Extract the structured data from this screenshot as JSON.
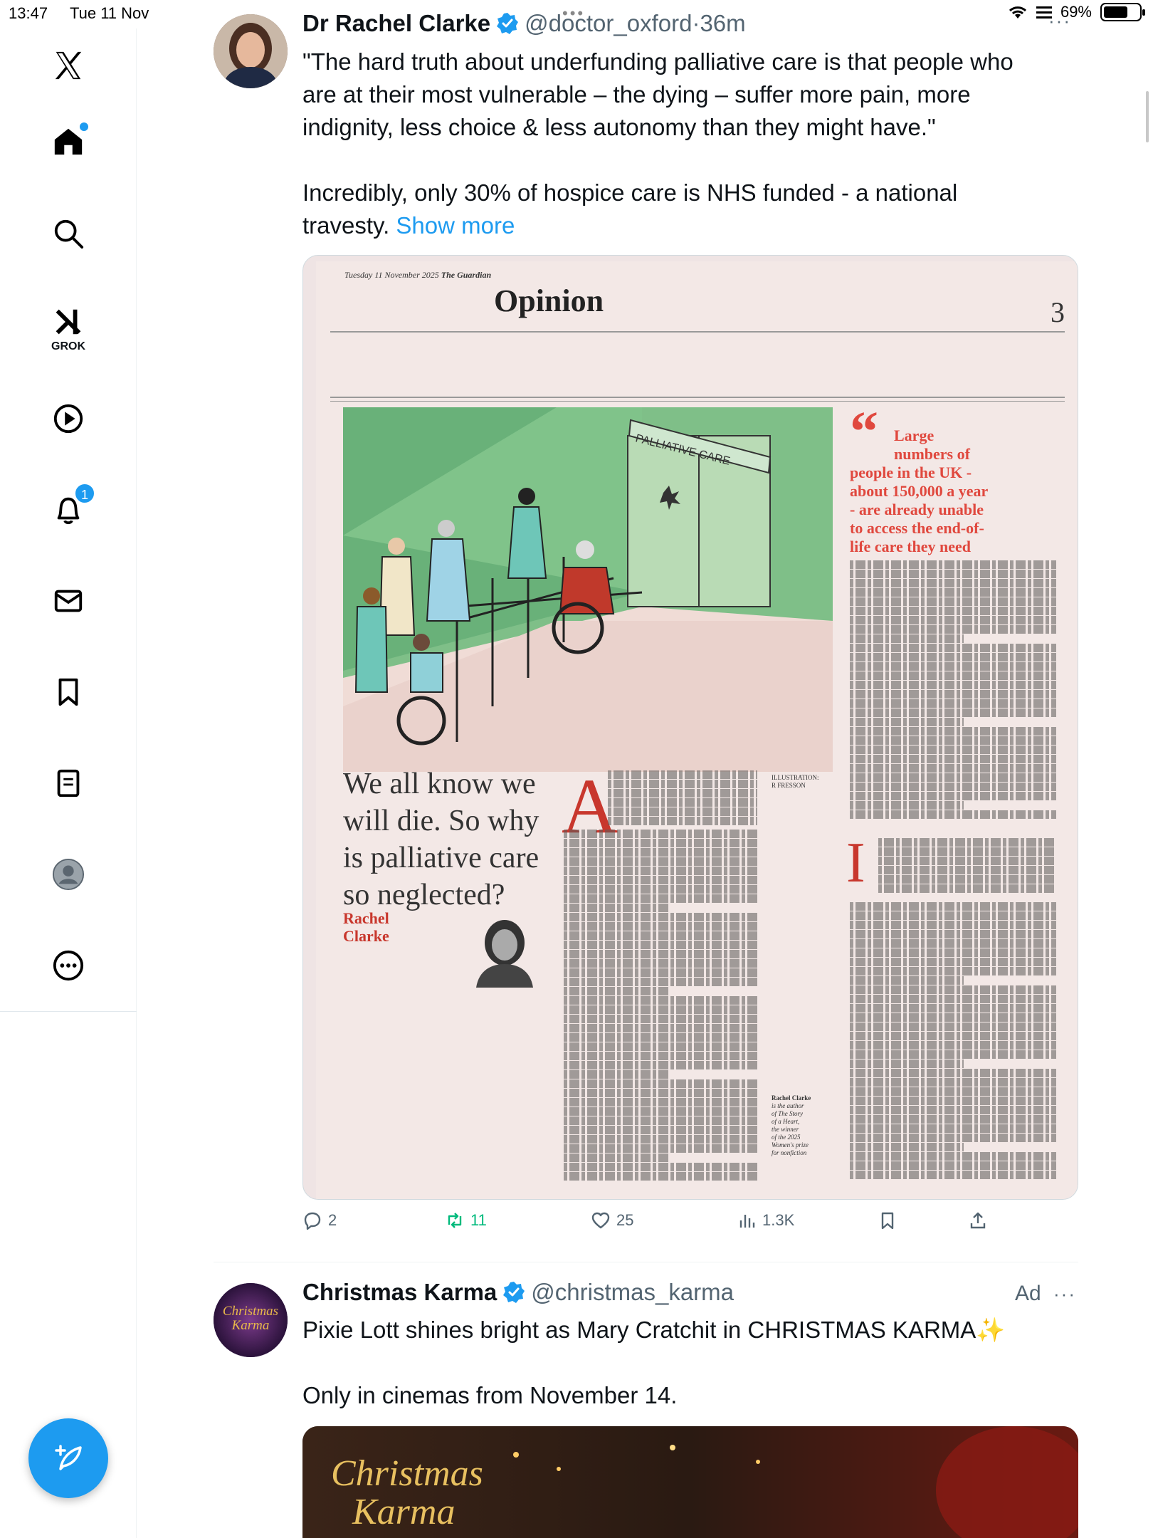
{
  "status_bar": {
    "time": "13:47",
    "date": "Tue 11 Nov",
    "battery": "69%",
    "battery_level": 0.69
  },
  "sidebar": {
    "logo": "x-logo-icon",
    "items": [
      {
        "icon": "home-icon",
        "label": ""
      },
      {
        "icon": "search-icon",
        "label": ""
      },
      {
        "icon": "grok-icon",
        "label": "GROK"
      },
      {
        "icon": "play-icon",
        "label": ""
      },
      {
        "icon": "bell-icon",
        "label": "",
        "badge": "1"
      },
      {
        "icon": "mail-icon",
        "label": ""
      },
      {
        "icon": "bookmark-icon",
        "label": ""
      },
      {
        "icon": "list-icon",
        "label": ""
      },
      {
        "icon": "profile-icon",
        "label": ""
      },
      {
        "icon": "more-icon",
        "label": ""
      }
    ],
    "compose_icon": "compose-icon"
  },
  "tweet1": {
    "name": "Dr Rachel Clarke",
    "handle": "@doctor_oxford",
    "time": "36m",
    "text_lines": [
      "\"The hard truth about underfunding palliative care is that people who",
      "are at their most vulnerable – the dying – suffer more pain, more",
      "indignity, less choice & less autonomy than they might have.\""
    ],
    "text_line4": "Incredibly, only 30% of hospice care is NHS funded - a national",
    "text_line5_pre": "travesty. ",
    "show_more": "Show more",
    "media": {
      "date": "Tuesday 11 November 2025",
      "paper": "The Guardian",
      "section": "Opinion",
      "page": "3",
      "sign_text": "PALLIATIVE CARE",
      "pull_quote_lines": [
        "Large",
        "numbers of",
        "people in the UK -",
        "about 150,000 a year",
        "- are already unable",
        "to access the end-of-",
        "life care they need"
      ],
      "headline_lines": [
        "We all know we",
        "will die. So why",
        "is palliative care",
        "so neglected?"
      ],
      "author_lines": [
        "Rachel",
        "Clarke"
      ],
      "dropcap": "A",
      "illustration_credit": "ILLUSTRATION: R FRESSON",
      "bio_lines": [
        "Rachel Clarke",
        "is the author",
        "of The Story",
        "of a Heart,",
        "the winner",
        "of the 2025",
        "Women's prize",
        "for nonfiction"
      ]
    },
    "actions": {
      "reply": "2",
      "retweet": "11",
      "like": "25",
      "views": "1.3K"
    },
    "accent": "#1d9bf0",
    "retweet_color": "#00ba7c"
  },
  "tweet2": {
    "name": "Christmas Karma",
    "handle": "@christmas_karma",
    "ad": "Ad",
    "text1": "Pixie Lott shines bright as Mary Cratchit in CHRISTMAS KARMA✨",
    "text2": "Only in cinemas from November 14.",
    "avatar_text": "Christmas Karma",
    "media_title_lines": [
      "Christmas",
      "Karma"
    ]
  }
}
